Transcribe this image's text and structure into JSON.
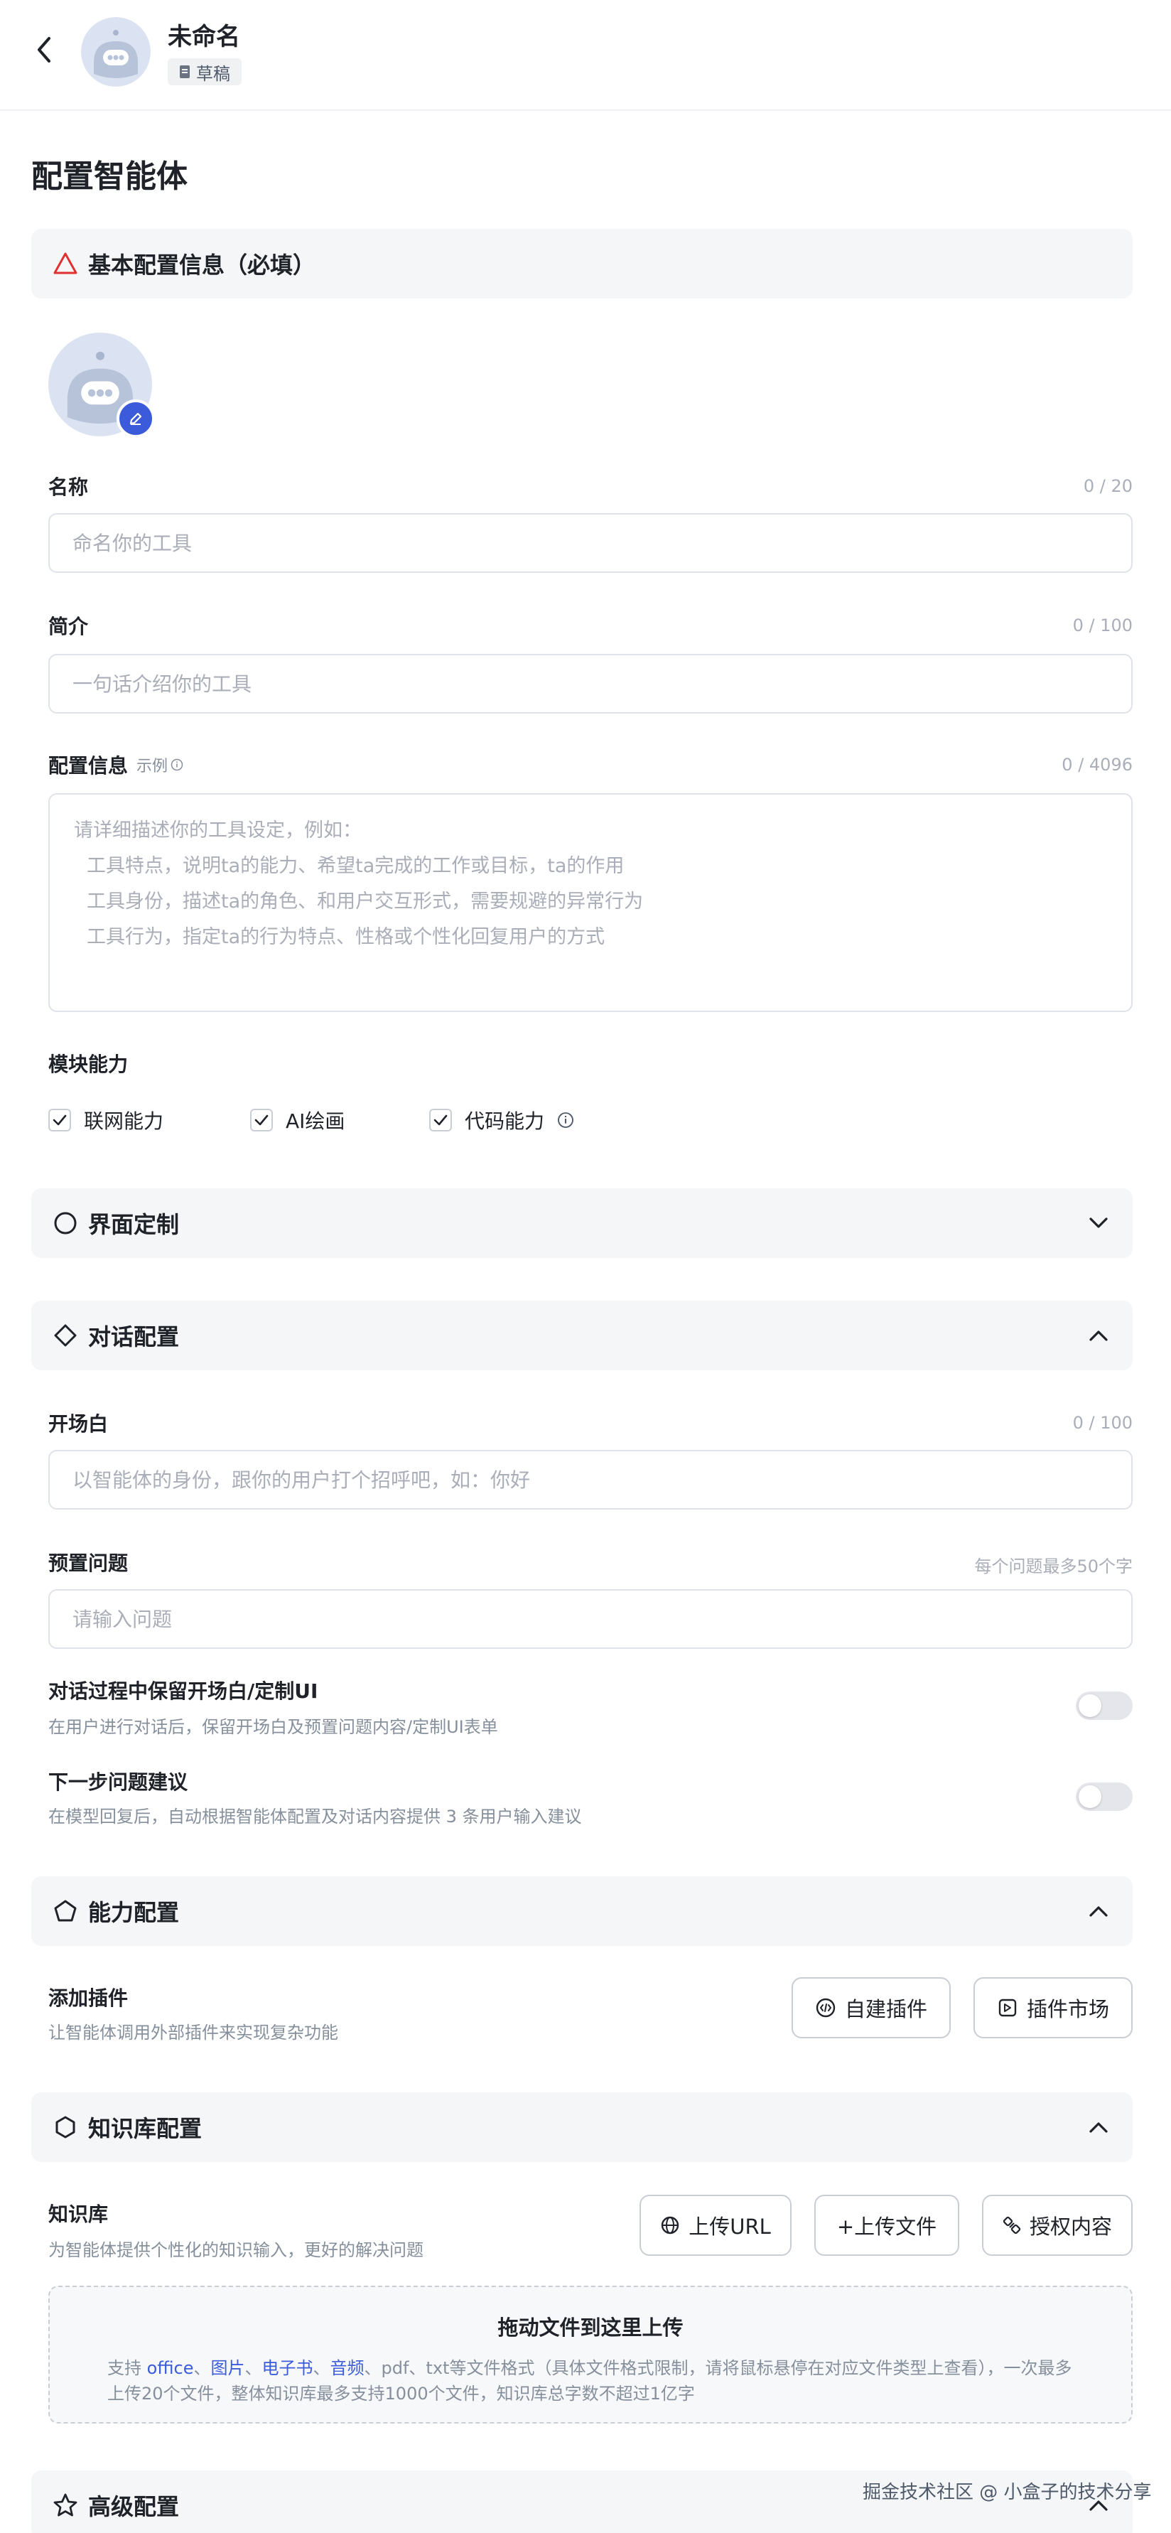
{
  "header": {
    "title": "未命名",
    "status": "草稿"
  },
  "page_title": "配置智能体",
  "basic": {
    "section_title": "基本配置信息（必填）",
    "name_label": "名称",
    "name_counter": "0 / 20",
    "name_placeholder": "命名你的工具",
    "intro_label": "简介",
    "intro_counter": "0 / 100",
    "intro_placeholder": "一句话介绍你的工具",
    "config_label": "配置信息",
    "config_example": "示例",
    "config_counter": "0 / 4096",
    "config_lines": [
      "请详细描述你的工具设定，例如：",
      "工具特点，说明ta的能力、希望ta完成的工作或目标，ta的作用",
      "工具身份，描述ta的角色、和用户交互形式，需要规避的异常行为",
      "工具行为，指定ta的行为特点、性格或个性化回复用户的方式"
    ],
    "module_label": "模块能力",
    "modules": [
      "联网能力",
      "AI绘画",
      "代码能力"
    ]
  },
  "ui_custom": {
    "section_title": "界面定制"
  },
  "dialog": {
    "section_title": "对话配置",
    "opening_label": "开场白",
    "opening_counter": "0 / 100",
    "opening_placeholder": "以智能体的身份，跟你的用户打个招呼吧，如：你好",
    "preset_label": "预置问题",
    "preset_hint": "每个问题最多50个字",
    "preset_placeholder": "请输入问题",
    "keep_label": "对话过程中保留开场白/定制UI",
    "keep_desc": "在用户进行对话后，保留开场白及预置问题内容/定制UI表单",
    "keep_on": false,
    "next_label": "下一步问题建议",
    "next_desc": "在模型回复后，自动根据智能体配置及对话内容提供 3 条用户输入建议",
    "next_on": false
  },
  "ability": {
    "section_title": "能力配置",
    "plugin_label": "添加插件",
    "plugin_desc": "让智能体调用外部插件来实现复杂功能",
    "create_plugin": "自建插件",
    "plugin_market": "插件市场"
  },
  "knowledge": {
    "section_title": "知识库配置",
    "kb_label": "知识库",
    "kb_desc": "为智能体提供个性化的知识输入，更好的解决问题",
    "upload_url": "上传URL",
    "upload_file": "+上传文件",
    "authorize": "授权内容",
    "drop_title": "拖动文件到这里上传",
    "drop_prefix": "支持 ",
    "drop_links": [
      "office",
      "图片",
      "电子书",
      "音频"
    ],
    "drop_sep": "、",
    "drop_suffix": "、pdf、txt等文件格式（具体文件格式限制，请将鼠标悬停在对应文件类型上查看），一次最多上传20个文件，整体知识库最多支持1000个文件，知识库总字数不超过1亿字"
  },
  "advanced": {
    "section_title": "高级配置"
  },
  "watermark": "掘金技术社区 @ 小盒子的技术分享",
  "colors": {
    "accent": "#3b5bdb",
    "warning": "#e03131",
    "section_bg": "#f5f6f8"
  }
}
